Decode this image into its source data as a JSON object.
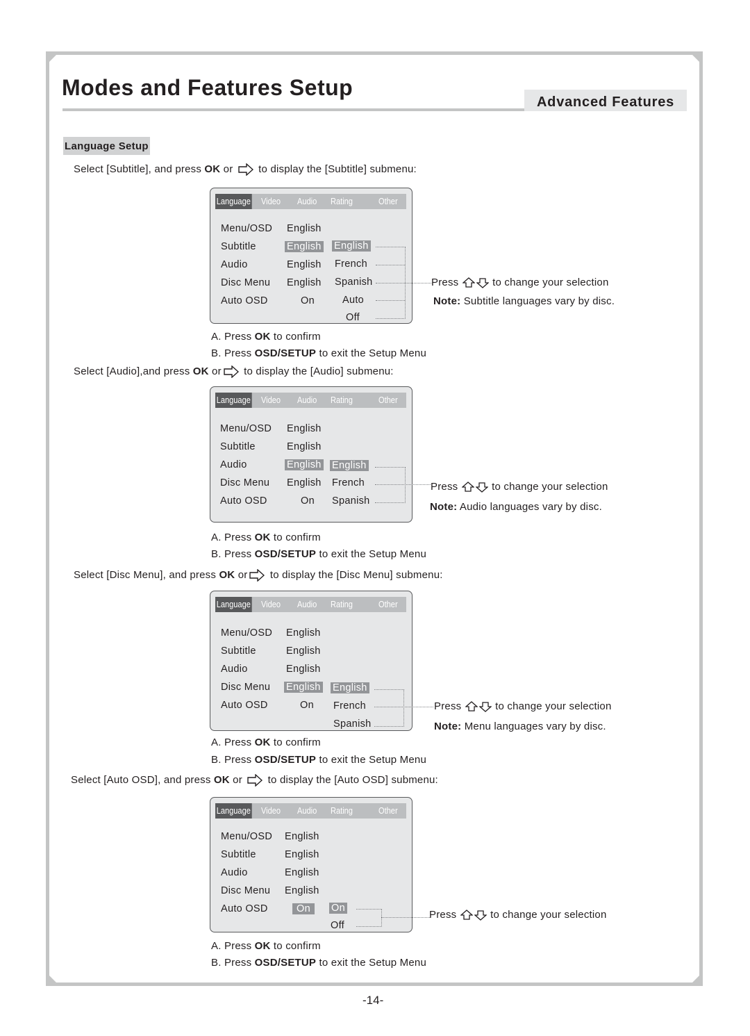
{
  "header": {
    "title": "Modes and Features Setup",
    "section": "Advanced Features"
  },
  "subsection": "Language Setup",
  "menu_tabs": [
    "Language",
    "Video",
    "Audio",
    "Rating",
    "Other"
  ],
  "menu_labels": [
    "Menu/OSD",
    "Subtitle",
    "Audio",
    "Disc Menu",
    "Auto OSD"
  ],
  "icons": {
    "right": "right-arrow-icon",
    "up": "up-arrow-icon",
    "down": "down-arrow-icon"
  },
  "common": {
    "confirm_prefix": "A.  Press ",
    "confirm_key": "OK",
    "confirm_suffix": " to confirm",
    "exit_prefix": "B.  Press ",
    "exit_key": "OSD/SETUP",
    "exit_suffix": " to exit the Setup Menu",
    "change_press": "Press",
    "change_suffix": "to change your selection",
    "note_label": "Note:"
  },
  "sections": [
    {
      "intro_prefix": "Select [Subtitle], and press ",
      "intro_key": "OK",
      "intro_or": " or ",
      "intro_suffix": " to display the [Subtitle] submenu:",
      "values": [
        "English",
        "English",
        "English",
        "English",
        "On"
      ],
      "selected_row": "Subtitle",
      "options": [
        "English",
        "French",
        "Spanish",
        "Auto",
        "Off"
      ],
      "note": "Subtitle languages vary by disc."
    },
    {
      "intro_prefix": "Select [Audio],and press ",
      "intro_key": "OK",
      "intro_or": " or",
      "intro_suffix": " to display the [Audio] submenu:",
      "values": [
        "English",
        "English",
        "English",
        "English",
        "On"
      ],
      "selected_row": "Audio",
      "options": [
        "English",
        "French",
        "Spanish"
      ],
      "note": "Audio languages vary by disc."
    },
    {
      "intro_prefix": "Select [Disc Menu], and press ",
      "intro_key": "OK",
      "intro_or": " or",
      "intro_suffix": " to display the [Disc Menu] submenu:",
      "values": [
        "English",
        "English",
        "English",
        "English",
        "On"
      ],
      "selected_row": "Disc Menu",
      "options": [
        "English",
        "French",
        "Spanish"
      ],
      "note": "Menu languages vary by disc."
    },
    {
      "intro_prefix": "Select [Auto OSD], and press ",
      "intro_key": "OK",
      "intro_or": " or ",
      "intro_suffix": " to display the [Auto OSD] submenu:",
      "values": [
        "English",
        "English",
        "English",
        "English",
        "On"
      ],
      "selected_row": "Auto OSD",
      "options": [
        "On",
        "Off"
      ]
    }
  ],
  "page_number": "-14-"
}
